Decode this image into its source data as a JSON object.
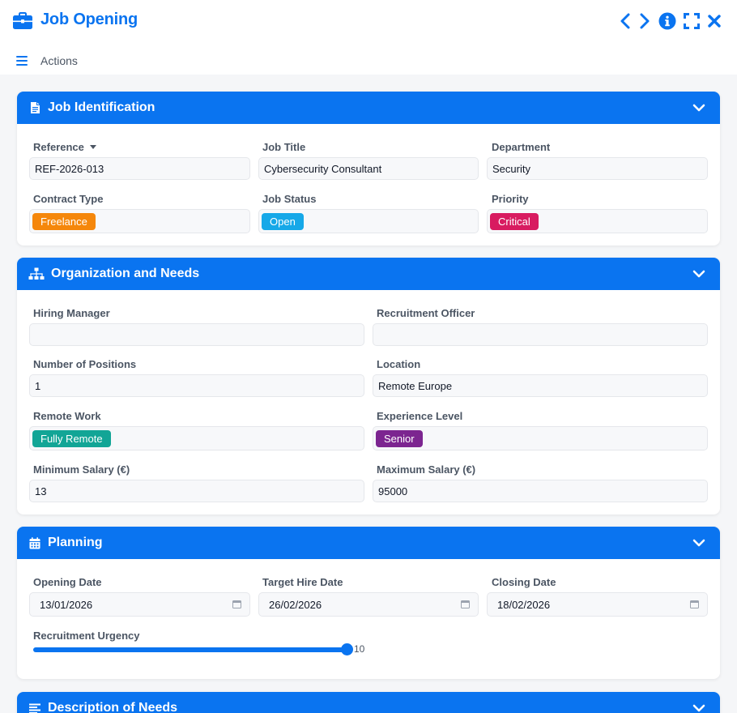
{
  "window": {
    "title": "Job Opening",
    "actions_label": "Actions",
    "icons": {
      "title": "briefcase-icon",
      "prev": "chevron-left-icon",
      "next": "chevron-right-icon",
      "info": "info-icon",
      "fullscreen": "fullscreen-icon",
      "close": "close-icon",
      "menu": "hamburger-menu-icon"
    }
  },
  "colors": {
    "primary": "#0a74f0",
    "freelance": "#f5870b",
    "open": "#16a8e8",
    "critical": "#d81b60",
    "fully_remote": "#12a596",
    "senior": "#7c2590"
  },
  "sections": {
    "identification": {
      "title": "Job Identification",
      "icon": "document-icon",
      "fields": {
        "reference": {
          "label": "Reference",
          "value": "REF-2026-013"
        },
        "job_title": {
          "label": "Job Title",
          "value": "Cybersecurity Consultant"
        },
        "department": {
          "label": "Department",
          "value": "Security"
        },
        "contract_type": {
          "label": "Contract Type",
          "value": "Freelance"
        },
        "job_status": {
          "label": "Job Status",
          "value": "Open"
        },
        "priority": {
          "label": "Priority",
          "value": "Critical"
        }
      }
    },
    "organization": {
      "title": "Organization and Needs",
      "icon": "org-chart-icon",
      "fields": {
        "hiring_manager": {
          "label": "Hiring Manager",
          "value": ""
        },
        "recruitment_officer": {
          "label": "Recruitment Officer",
          "value": ""
        },
        "positions": {
          "label": "Number of Positions",
          "value": "1"
        },
        "location": {
          "label": "Location",
          "value": "Remote Europe"
        },
        "remote_work": {
          "label": "Remote Work",
          "value": "Fully Remote"
        },
        "experience_level": {
          "label": "Experience Level",
          "value": "Senior"
        },
        "min_salary": {
          "label": "Minimum Salary (€)",
          "value": "13"
        },
        "max_salary": {
          "label": "Maximum Salary (€)",
          "value": "95000"
        }
      }
    },
    "planning": {
      "title": "Planning",
      "icon": "calendar-icon",
      "fields": {
        "opening_date": {
          "label": "Opening Date",
          "value": "13/01/2026"
        },
        "target_hire_date": {
          "label": "Target Hire Date",
          "value": "26/02/2026"
        },
        "closing_date": {
          "label": "Closing Date",
          "value": "18/02/2026"
        },
        "urgency": {
          "label": "Recruitment Urgency",
          "value": "10",
          "max": 10
        }
      }
    },
    "description": {
      "title": "Description of Needs",
      "icon": "text-lines-icon"
    }
  }
}
